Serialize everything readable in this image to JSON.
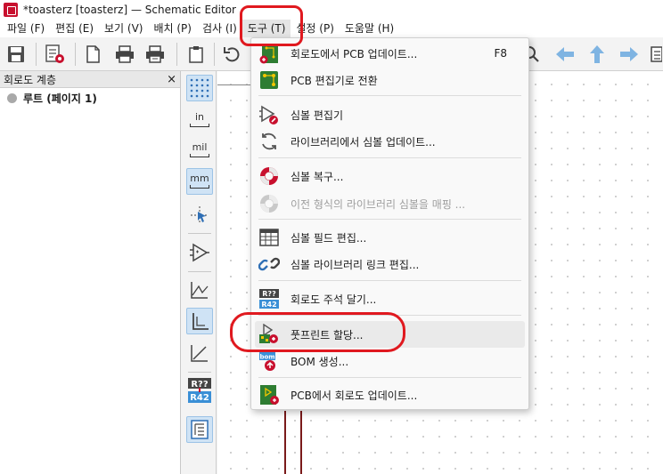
{
  "window": {
    "title": "*toasterz [toasterz] — Schematic Editor"
  },
  "menubar": {
    "items": [
      {
        "label": "파일 (F)"
      },
      {
        "label": "편집 (E)"
      },
      {
        "label": "보기 (V)"
      },
      {
        "label": "배치 (P)"
      },
      {
        "label": "검사 (I)"
      },
      {
        "label": "도구 (T)"
      },
      {
        "label": "설정 (P)"
      },
      {
        "label": "도움말 (H)"
      }
    ]
  },
  "hierarchy_panel": {
    "title": "회로도 계층",
    "close_glyph": "×",
    "root_label": "루트 (페이지 1)"
  },
  "units": {
    "in": "in",
    "mil": "mil",
    "mm": "mm"
  },
  "annotate_icon": {
    "top": "R??",
    "bottom": "R42"
  },
  "tools_menu": {
    "items": [
      {
        "label": "회로도에서 PCB 업데이트...",
        "shortcut": "F8"
      },
      {
        "label": "PCB 편집기로 전환"
      },
      {
        "label": "심볼 편집기"
      },
      {
        "label": "라이브러리에서 심볼 업데이트..."
      },
      {
        "label": "심볼 복구..."
      },
      {
        "label": "이전 형식의 라이브러리 심볼을 매핑 ..."
      },
      {
        "label": "심볼 필드 편집..."
      },
      {
        "label": "심볼 라이브러리 링크 편집..."
      },
      {
        "label": "회로도 주석 달기..."
      },
      {
        "label": "풋프린트 할당..."
      },
      {
        "label": "BOM 생성..."
      },
      {
        "label": "PCB에서 회로도 업데이트..."
      }
    ],
    "bom_icon_text": "bom"
  },
  "colors": {
    "highlight": "#e0191f",
    "accent": "#3a8fd6",
    "wire": "#7a1a1a"
  }
}
